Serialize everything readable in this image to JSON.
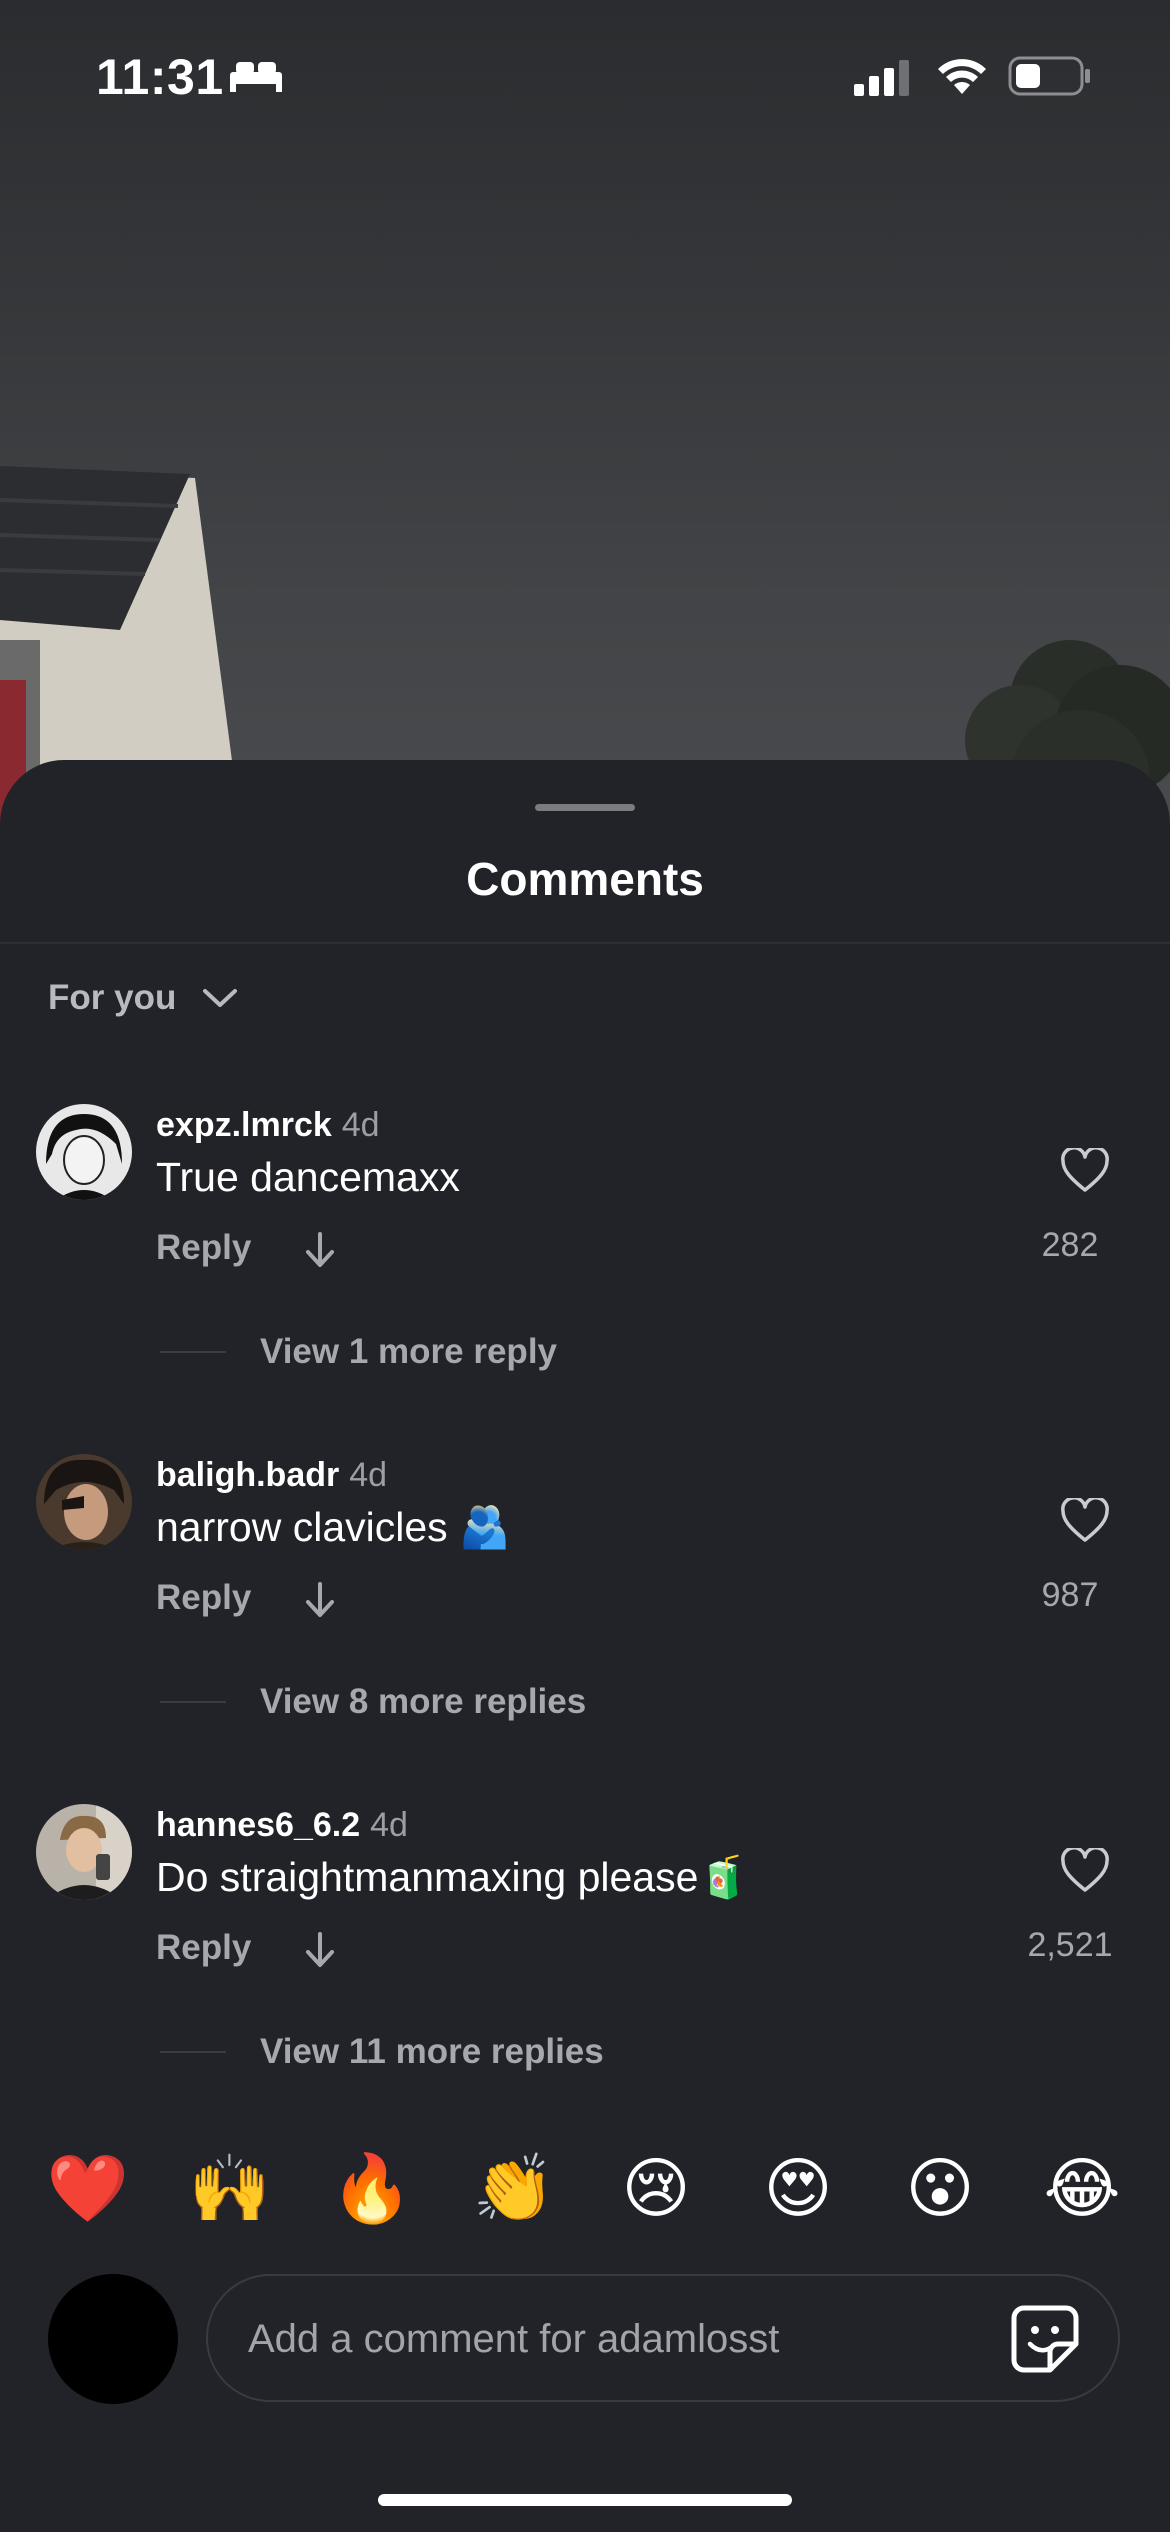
{
  "status_bar": {
    "time": "11:31",
    "focus_icon": "bed-icon",
    "signal_icon": "cellular-signal-icon",
    "wifi_icon": "wifi-icon",
    "battery_icon": "battery-icon"
  },
  "sheet": {
    "title": "Comments",
    "filter_label": "For you"
  },
  "comments": [
    {
      "username": "expz.lmrck",
      "age": "4d",
      "text": "True dancemaxx",
      "reply_label": "Reply",
      "likes": "282",
      "more_replies": "View 1 more reply"
    },
    {
      "username": "baligh.badr",
      "age": "4d",
      "text": "narrow clavicles 🫂",
      "reply_label": "Reply",
      "likes": "987",
      "more_replies": "View 8 more replies"
    },
    {
      "username": "hannes6_6.2",
      "age": "4d",
      "text": "Do straightmanmaxing please🧃",
      "reply_label": "Reply",
      "likes": "2,521",
      "more_replies": "View 11 more replies"
    }
  ],
  "emoji_bar": [
    "❤️",
    "🙌",
    "🔥",
    "👏",
    "😢",
    "😍",
    "😮",
    "😂"
  ],
  "composer": {
    "placeholder": "Add a comment for adamlosst",
    "sticker_icon": "sticker-icon"
  },
  "colors": {
    "sheet_background": "#222328",
    "secondary_text": "#a6a8ae"
  }
}
